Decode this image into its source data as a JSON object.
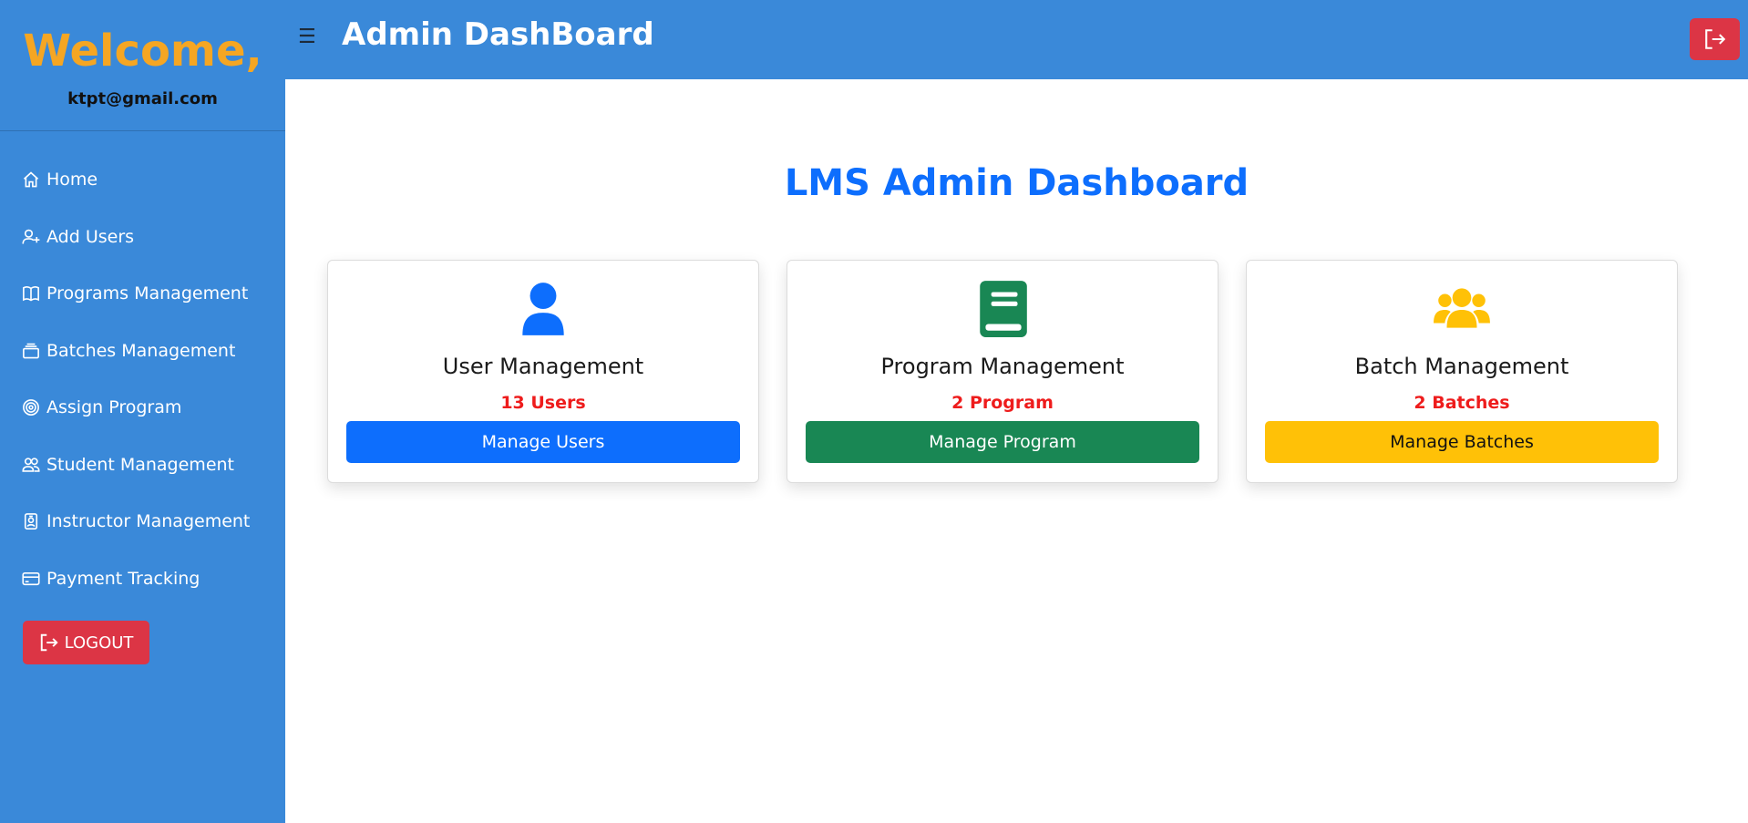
{
  "sidebar": {
    "welcome": "Welcome,",
    "email": "ktpt@gmail.com",
    "items": [
      {
        "label": "Home",
        "icon": "home-icon"
      },
      {
        "label": "Add Users",
        "icon": "person-add-icon"
      },
      {
        "label": "Programs Management",
        "icon": "book-icon"
      },
      {
        "label": "Batches Management",
        "icon": "collection-icon"
      },
      {
        "label": "Assign Program",
        "icon": "target-icon"
      },
      {
        "label": "Student Management",
        "icon": "people-icon"
      },
      {
        "label": "Instructor Management",
        "icon": "person-badge-icon"
      },
      {
        "label": "Payment Tracking",
        "icon": "credit-card-icon"
      }
    ],
    "logout_label": "LOGOUT"
  },
  "header": {
    "menu_glyph": "☰",
    "title": "Admin DashBoard"
  },
  "main": {
    "title": "LMS Admin Dashboard",
    "cards": [
      {
        "title": "User Management",
        "count": "13 Users",
        "button": "Manage Users",
        "icon": "user-icon",
        "color": "#0d6efd",
        "text_color": "#ffffff"
      },
      {
        "title": "Program Management",
        "count": "2 Program",
        "button": "Manage Program",
        "icon": "book-icon",
        "color": "#198754",
        "text_color": "#ffffff"
      },
      {
        "title": "Batch Management",
        "count": "2 Batches",
        "button": "Manage Batches",
        "icon": "users-icon",
        "color": "#ffc107",
        "text_color": "#111111"
      }
    ]
  },
  "colors": {
    "sidebar_bg": "#3a89d9",
    "welcome": "#f5a623",
    "danger": "#dc3545",
    "title_blue": "#0d6efd",
    "count_red": "#ee1c1c"
  }
}
